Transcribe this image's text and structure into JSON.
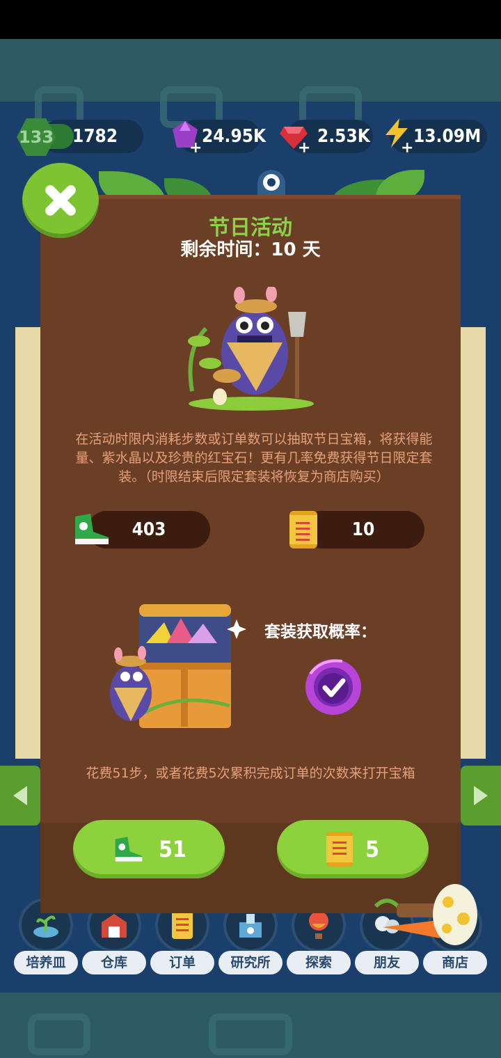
{
  "hud": {
    "level": "133",
    "steps": "1782",
    "crystal": "24.95K",
    "ruby": "2.53K",
    "energy": "13.09M"
  },
  "modal": {
    "title": "节日活动",
    "time_left": "剩余时间：10 天",
    "description": "在活动时限内消耗步数或订单数可以抽取节日宝箱，将获得能量、紫水晶以及珍贵的红宝石！更有几率免费获得节日限定套装。（时限结束后限定套装将恢复为商店购买）",
    "steps_owned": "403",
    "orders_owned": "10",
    "suit_rate_label": "套装获取概率：",
    "open_note": "花费51步，或者花费5次累积完成订单的次数来打开宝箱",
    "steps_cost": "51",
    "orders_cost": "5"
  },
  "nav": [
    {
      "label": "培养皿",
      "icon": "petri-dish-icon"
    },
    {
      "label": "仓库",
      "icon": "warehouse-icon"
    },
    {
      "label": "订单",
      "icon": "order-scroll-icon"
    },
    {
      "label": "研究所",
      "icon": "lab-icon"
    },
    {
      "label": "探索",
      "icon": "balloon-icon"
    },
    {
      "label": "朋友",
      "icon": "friends-icon"
    },
    {
      "label": "商店",
      "icon": "shop-icon"
    }
  ],
  "colors": {
    "modal_bg": "#6b3f26",
    "accent_green": "#8dd13c",
    "title_green": "#8bd14a",
    "desc_orange": "#e6a07a"
  }
}
